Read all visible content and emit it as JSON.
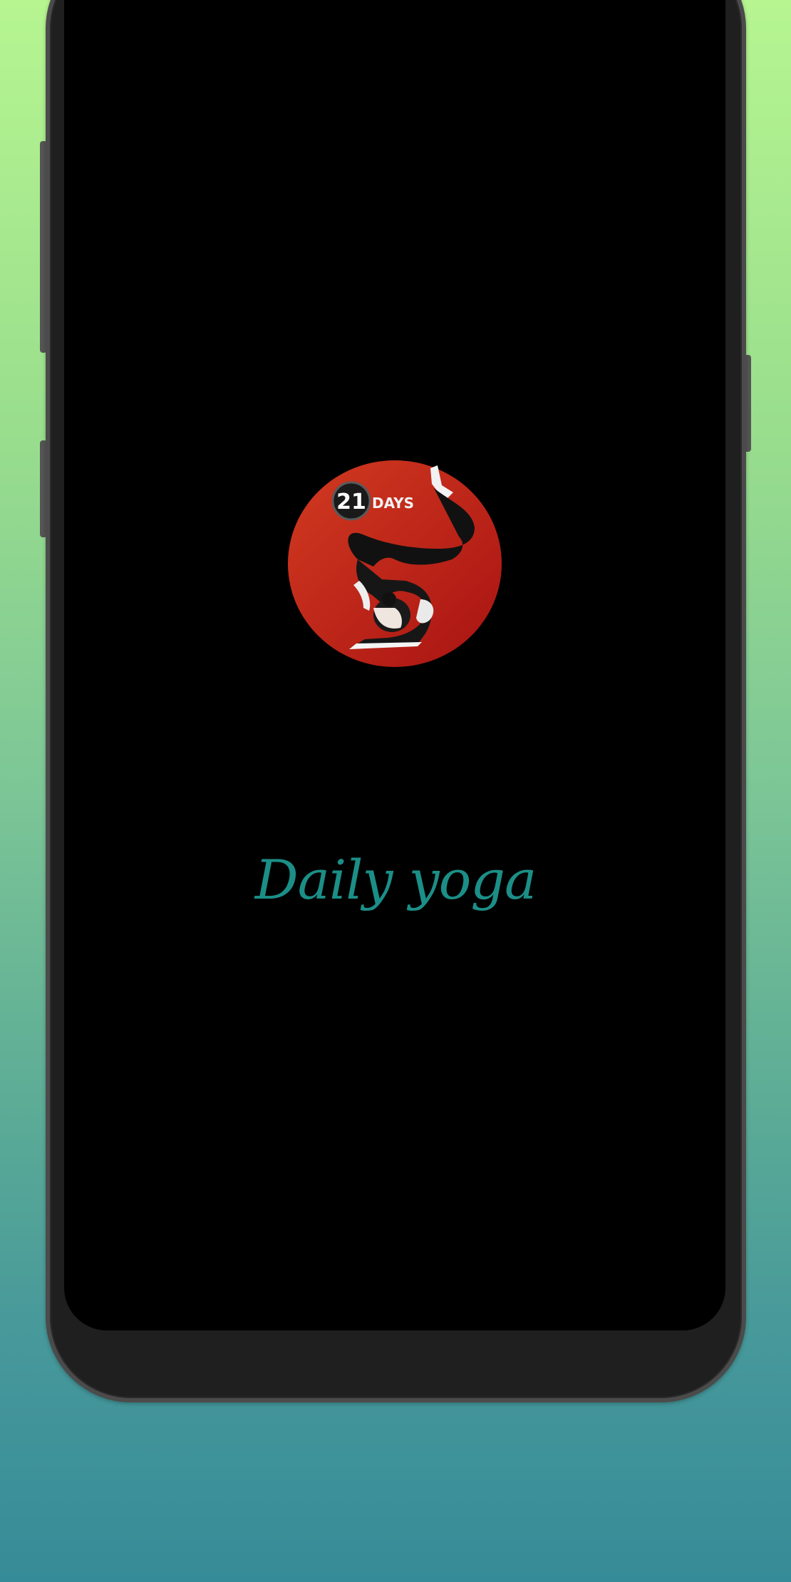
{
  "app": {
    "name": "Daily yoga",
    "logo": {
      "badge_number": "21",
      "badge_text": "DAYS",
      "icon": "yoga-pose-icon"
    }
  },
  "colors": {
    "background_top": "#b6f590",
    "background_bottom": "#368b98",
    "screen": "#000000",
    "title": "#1b8f87",
    "logo_red": "#c72a1a"
  }
}
